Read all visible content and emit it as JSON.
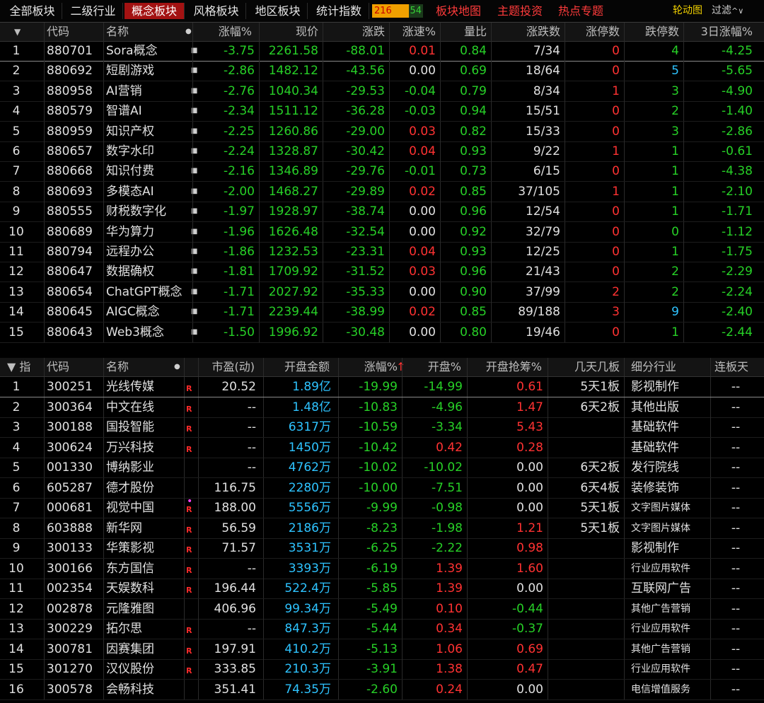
{
  "tabs": [
    "全部板块",
    "二级行业",
    "概念板块",
    "风格板块",
    "地区板块",
    "统计指数"
  ],
  "active_tab": 2,
  "counter": {
    "up": "216",
    "down": "54"
  },
  "links": [
    "板块地图",
    "主题投资",
    "热点专题"
  ],
  "tools": {
    "rotation": "轮动图",
    "filter": "过滤",
    "filter_caret": "^∨"
  },
  "top": {
    "headers": [
      "代码",
      "名称",
      "涨幅%",
      "现价",
      "涨跌",
      "涨速%",
      "量比",
      "涨跌数",
      "涨停数",
      "跌停数",
      "3日涨幅%"
    ],
    "sort_arrow": "↑",
    "dropdown": "▼",
    "rows": [
      {
        "i": "1",
        "code": "880701",
        "name": "Sora概念",
        "pct": "-3.75",
        "price": "2261.58",
        "chg": "-88.01",
        "speed": "0.01",
        "vr": "0.84",
        "updown": "7/34",
        "lu": "0",
        "ld": "4",
        "d3": "-4.25"
      },
      {
        "i": "2",
        "code": "880692",
        "name": "短剧游戏",
        "pct": "-2.86",
        "price": "1482.12",
        "chg": "-43.56",
        "speed": "0.00",
        "vr": "0.69",
        "updown": "18/64",
        "lu": "0",
        "ld": "5",
        "d3": "-5.65"
      },
      {
        "i": "3",
        "code": "880958",
        "name": "AI营销",
        "pct": "-2.76",
        "price": "1040.34",
        "chg": "-29.53",
        "speed": "-0.04",
        "vr": "0.79",
        "updown": "8/34",
        "lu": "1",
        "ld": "3",
        "d3": "-4.90"
      },
      {
        "i": "4",
        "code": "880579",
        "name": "智谱AI",
        "pct": "-2.34",
        "price": "1511.12",
        "chg": "-36.28",
        "speed": "-0.03",
        "vr": "0.94",
        "updown": "15/51",
        "lu": "0",
        "ld": "2",
        "d3": "-1.40"
      },
      {
        "i": "5",
        "code": "880959",
        "name": "知识产权",
        "pct": "-2.25",
        "price": "1260.86",
        "chg": "-29.00",
        "speed": "0.03",
        "vr": "0.82",
        "updown": "15/33",
        "lu": "0",
        "ld": "3",
        "d3": "-2.86"
      },
      {
        "i": "6",
        "code": "880657",
        "name": "数字水印",
        "pct": "-2.24",
        "price": "1328.87",
        "chg": "-30.42",
        "speed": "0.04",
        "vr": "0.93",
        "updown": "9/22",
        "lu": "1",
        "ld": "1",
        "d3": "-0.61"
      },
      {
        "i": "7",
        "code": "880668",
        "name": "知识付费",
        "pct": "-2.16",
        "price": "1346.89",
        "chg": "-29.76",
        "speed": "-0.01",
        "vr": "0.73",
        "updown": "6/15",
        "lu": "0",
        "ld": "1",
        "d3": "-4.38"
      },
      {
        "i": "8",
        "code": "880693",
        "name": "多模态AI",
        "pct": "-2.00",
        "price": "1468.27",
        "chg": "-29.89",
        "speed": "0.02",
        "vr": "0.85",
        "updown": "37/105",
        "lu": "1",
        "ld": "1",
        "d3": "-2.10"
      },
      {
        "i": "9",
        "code": "880555",
        "name": "财税数字化",
        "pct": "-1.97",
        "price": "1928.97",
        "chg": "-38.74",
        "speed": "0.00",
        "vr": "0.96",
        "updown": "12/54",
        "lu": "0",
        "ld": "1",
        "d3": "-1.71"
      },
      {
        "i": "10",
        "code": "880689",
        "name": "华为算力",
        "pct": "-1.96",
        "price": "1626.48",
        "chg": "-32.54",
        "speed": "0.00",
        "vr": "0.92",
        "updown": "32/79",
        "lu": "0",
        "ld": "0",
        "d3": "-1.12"
      },
      {
        "i": "11",
        "code": "880794",
        "name": "远程办公",
        "pct": "-1.86",
        "price": "1232.53",
        "chg": "-23.31",
        "speed": "0.04",
        "vr": "0.93",
        "updown": "12/25",
        "lu": "0",
        "ld": "1",
        "d3": "-1.75"
      },
      {
        "i": "12",
        "code": "880647",
        "name": "数据确权",
        "pct": "-1.81",
        "price": "1709.92",
        "chg": "-31.52",
        "speed": "0.03",
        "vr": "0.96",
        "updown": "21/43",
        "lu": "0",
        "ld": "2",
        "d3": "-2.29"
      },
      {
        "i": "13",
        "code": "880654",
        "name": "ChatGPT概念",
        "pct": "-1.71",
        "price": "2027.92",
        "chg": "-35.33",
        "speed": "0.00",
        "vr": "0.90",
        "updown": "37/99",
        "lu": "2",
        "ld": "2",
        "d3": "-2.24"
      },
      {
        "i": "14",
        "code": "880645",
        "name": "AIGC概念",
        "pct": "-1.71",
        "price": "2239.44",
        "chg": "-38.99",
        "speed": "0.02",
        "vr": "0.85",
        "updown": "89/188",
        "lu": "3",
        "ld": "9",
        "d3": "-2.40"
      },
      {
        "i": "15",
        "code": "880643",
        "name": "Web3概念",
        "pct": "-1.50",
        "price": "1996.92",
        "chg": "-30.48",
        "speed": "0.00",
        "vr": "0.80",
        "updown": "19/46",
        "lu": "0",
        "ld": "1",
        "d3": "-2.44"
      }
    ]
  },
  "bottom": {
    "index_label": "▼ 指",
    "headers": [
      "代码",
      "名称",
      "市盈(动)",
      "开盘金额",
      "涨幅%",
      "开盘%",
      "开盘抢筹%",
      "几天几板",
      "细分行业",
      "连板天"
    ],
    "sort_arrow": "↑",
    "rows": [
      {
        "i": "1",
        "code": "300251",
        "name": "光线传媒",
        "r": "R",
        "pe": "20.52",
        "amt": "1.89亿",
        "pct": "-19.99",
        "open": "-14.99",
        "grab": "0.61",
        "days": "5天1板",
        "ind": "影视制作",
        "lb": "--"
      },
      {
        "i": "2",
        "code": "300364",
        "name": "中文在线",
        "r": "R",
        "pe": "--",
        "amt": "1.48亿",
        "pct": "-10.83",
        "open": "-4.96",
        "grab": "1.47",
        "days": "6天2板",
        "ind": "其他出版",
        "lb": "--"
      },
      {
        "i": "3",
        "code": "300188",
        "name": "国投智能",
        "r": "R",
        "pe": "--",
        "amt": "6317万",
        "pct": "-10.59",
        "open": "-3.34",
        "grab": "5.43",
        "days": "",
        "ind": "基础软件",
        "lb": "--"
      },
      {
        "i": "4",
        "code": "300624",
        "name": "万兴科技",
        "r": "R",
        "pe": "--",
        "amt": "1450万",
        "pct": "-10.42",
        "open": "0.42",
        "grab": "0.28",
        "days": "",
        "ind": "基础软件",
        "lb": "--"
      },
      {
        "i": "5",
        "code": "001330",
        "name": "博纳影业",
        "r": "",
        "pe": "--",
        "amt": "4762万",
        "pct": "-10.02",
        "open": "-10.02",
        "grab": "0.00",
        "days": "6天2板",
        "ind": "发行院线",
        "lb": "--"
      },
      {
        "i": "6",
        "code": "605287",
        "name": "德才股份",
        "r": "",
        "pe": "116.75",
        "amt": "2280万",
        "pct": "-10.00",
        "open": "-7.51",
        "grab": "0.00",
        "days": "6天4板",
        "ind": "装修装饰",
        "lb": "--"
      },
      {
        "i": "7",
        "code": "000681",
        "name": "视觉中国",
        "r": "R",
        "pe": "188.00",
        "amt": "5556万",
        "pct": "-9.99",
        "open": "-0.98",
        "grab": "0.00",
        "days": "5天1板",
        "ind": "文字图片媒体",
        "lb": "--"
      },
      {
        "i": "8",
        "code": "603888",
        "name": "新华网",
        "r": "R",
        "pe": "56.59",
        "amt": "2186万",
        "pct": "-8.23",
        "open": "-1.98",
        "grab": "1.21",
        "days": "5天1板",
        "ind": "文字图片媒体",
        "lb": "--"
      },
      {
        "i": "9",
        "code": "300133",
        "name": "华策影视",
        "r": "R",
        "pe": "71.57",
        "amt": "3531万",
        "pct": "-6.25",
        "open": "-2.22",
        "grab": "0.98",
        "days": "",
        "ind": "影视制作",
        "lb": "--"
      },
      {
        "i": "10",
        "code": "300166",
        "name": "东方国信",
        "r": "R",
        "pe": "--",
        "amt": "3393万",
        "pct": "-6.19",
        "open": "1.39",
        "grab": "1.60",
        "days": "",
        "ind": "行业应用软件",
        "lb": "--"
      },
      {
        "i": "11",
        "code": "002354",
        "name": "天娱数科",
        "r": "R",
        "pe": "196.44",
        "amt": "522.4万",
        "pct": "-5.85",
        "open": "1.39",
        "grab": "0.00",
        "days": "",
        "ind": "互联网广告",
        "lb": "--"
      },
      {
        "i": "12",
        "code": "002878",
        "name": "元隆雅图",
        "r": "",
        "pe": "406.96",
        "amt": "99.34万",
        "pct": "-5.49",
        "open": "0.10",
        "grab": "-0.44",
        "days": "",
        "ind": "其他广告营销",
        "lb": "--"
      },
      {
        "i": "13",
        "code": "300229",
        "name": "拓尔思",
        "r": "R",
        "pe": "--",
        "amt": "847.3万",
        "pct": "-5.44",
        "open": "0.34",
        "grab": "-0.37",
        "days": "",
        "ind": "行业应用软件",
        "lb": "--"
      },
      {
        "i": "14",
        "code": "300781",
        "name": "因赛集团",
        "r": "R",
        "pe": "197.91",
        "amt": "410.2万",
        "pct": "-5.13",
        "open": "1.06",
        "grab": "0.69",
        "days": "",
        "ind": "其他广告营销",
        "lb": "--"
      },
      {
        "i": "15",
        "code": "301270",
        "name": "汉仪股份",
        "r": "R",
        "pe": "333.85",
        "amt": "210.3万",
        "pct": "-3.91",
        "open": "1.38",
        "grab": "0.47",
        "days": "",
        "ind": "行业应用软件",
        "lb": "--"
      },
      {
        "i": "16",
        "code": "300578",
        "name": "会畅科技",
        "r": "",
        "pe": "351.41",
        "amt": "74.35万",
        "pct": "-2.60",
        "open": "0.24",
        "grab": "0.00",
        "days": "",
        "ind": "电信增值服务",
        "lb": "--"
      }
    ]
  },
  "colors": {
    "up": "#ff3232",
    "down": "#27d027",
    "neutral": "#e0e0e0",
    "amount": "#2ec3ff",
    "active_tab": "#a31212"
  }
}
